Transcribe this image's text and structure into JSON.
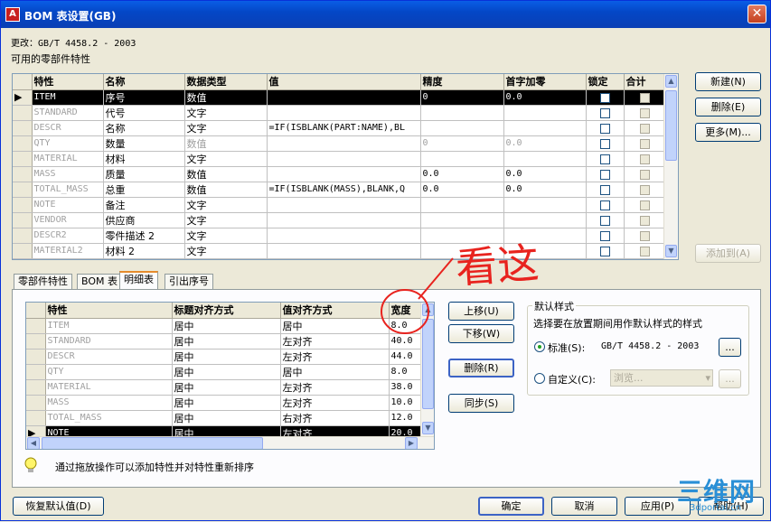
{
  "window": {
    "title": "BOM 表设置(GB)",
    "close": "✕",
    "app_icon": "A"
  },
  "header": {
    "change_label": "更改：GB/T 4458.2 - 2003",
    "available_label": "可用的零部件特性"
  },
  "props_table": {
    "columns": [
      "特性",
      "名称",
      "数据类型",
      "值",
      "精度",
      "首字加零",
      "锁定",
      "合计"
    ],
    "rows": [
      {
        "prop": "ITEM",
        "name": "序号",
        "type": "数值",
        "value": "",
        "precision": "0",
        "leadzero": "0.0",
        "selected": true
      },
      {
        "prop": "STANDARD",
        "name": "代号",
        "type": "文字",
        "value": "",
        "precision": "",
        "leadzero": ""
      },
      {
        "prop": "DESCR",
        "name": "名称",
        "type": "文字",
        "value": "=IF(ISBLANK(PART:NAME),BL",
        "precision": "",
        "leadzero": ""
      },
      {
        "prop": "QTY",
        "name": "数量",
        "type": "数值",
        "value": "",
        "precision": "0",
        "leadzero": "0.0",
        "gray_type": true
      },
      {
        "prop": "MATERIAL",
        "name": "材料",
        "type": "文字",
        "value": "",
        "precision": "",
        "leadzero": ""
      },
      {
        "prop": "MASS",
        "name": "质量",
        "type": "数值",
        "value": "",
        "precision": "0.0",
        "leadzero": "0.0"
      },
      {
        "prop": "TOTAL_MASS",
        "name": "总重",
        "type": "数值",
        "value": "=IF(ISBLANK(MASS),BLANK,Q",
        "precision": "0.0",
        "leadzero": "0.0"
      },
      {
        "prop": "NOTE",
        "name": "备注",
        "type": "文字",
        "value": "",
        "precision": "",
        "leadzero": ""
      },
      {
        "prop": "VENDOR",
        "name": "供应商",
        "type": "文字",
        "value": "",
        "precision": "",
        "leadzero": ""
      },
      {
        "prop": "DESCR2",
        "name": "零件描述 2",
        "type": "文字",
        "value": "",
        "precision": "",
        "leadzero": ""
      },
      {
        "prop": "MATERIAL2",
        "name": "材料 2",
        "type": "文字",
        "value": "",
        "precision": "",
        "leadzero": ""
      }
    ]
  },
  "side_buttons": {
    "new": "新建(N)",
    "delete": "删除(E)",
    "more": "更多(M)...",
    "add_to": "添加到(A)"
  },
  "tabs": [
    "零部件特性",
    "BOM 表",
    "明细表",
    "引出序号"
  ],
  "detail_table": {
    "columns": [
      "特性",
      "标题对齐方式",
      "值对齐方式",
      "宽度"
    ],
    "rows": [
      {
        "prop": "ITEM",
        "title_align": "居中",
        "value_align": "居中",
        "width": "8.0"
      },
      {
        "prop": "STANDARD",
        "title_align": "居中",
        "value_align": "左对齐",
        "width": "40.0"
      },
      {
        "prop": "DESCR",
        "title_align": "居中",
        "value_align": "左对齐",
        "width": "44.0"
      },
      {
        "prop": "QTY",
        "title_align": "居中",
        "value_align": "居中",
        "width": "8.0"
      },
      {
        "prop": "MATERIAL",
        "title_align": "居中",
        "value_align": "左对齐",
        "width": "38.0"
      },
      {
        "prop": "MASS",
        "title_align": "居中",
        "value_align": "左对齐",
        "width": "10.0"
      },
      {
        "prop": "TOTAL_MASS",
        "title_align": "居中",
        "value_align": "右对齐",
        "width": "12.0"
      },
      {
        "prop": "NOTE",
        "title_align": "居中",
        "value_align": "左对齐",
        "width": "20.0",
        "selected": true
      }
    ]
  },
  "order_buttons": {
    "up": "上移(U)",
    "down": "下移(W)",
    "delete": "删除(R)",
    "sync": "同步(S)"
  },
  "default_style": {
    "group_title": "默认样式",
    "description": "选择要在放置期间用作默认样式的样式",
    "standard_label": "标准(S):",
    "standard_value": "GB/T 4458.2 - 2003",
    "custom_label": "自定义(C):",
    "custom_placeholder": "浏览...",
    "browse": "...",
    "selected": "standard"
  },
  "hint": {
    "text": "通过拖放操作可以添加特性并对特性重新排序"
  },
  "footer": {
    "restore": "恢复默认值(D)",
    "ok": "确定",
    "cancel": "取消",
    "apply": "应用(P)",
    "help": "帮助(H)"
  },
  "annotation": {
    "text": "看这",
    "color": "#e8231e"
  },
  "watermark": {
    "text": "三维网",
    "sub": "3dportal.cn",
    "color": "#2a8fd6"
  }
}
